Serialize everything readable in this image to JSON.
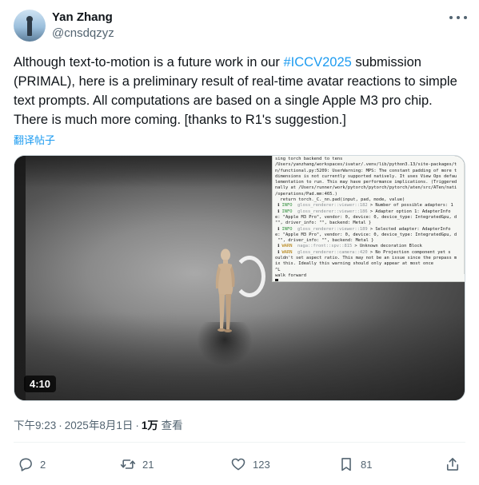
{
  "author": {
    "display_name": "Yan Zhang",
    "handle": "@cnsdqzyz"
  },
  "tweet": {
    "text_before": "Although text-to-motion is a future work in our ",
    "hashtag": "#ICCV2025",
    "text_after": " submission (PRIMAL), here is a preliminary result of real-time avatar reactions to simple text prompts. All computations are based on a single Apple M3 pro chip. There is much more coming. [thanks to R1's suggestion.]",
    "translate_label": "翻译帖子"
  },
  "video": {
    "duration": "4:10",
    "terminal_lines": [
      {
        "kind": "plain",
        "text": "sing torch backend to tens"
      },
      {
        "kind": "plain",
        "text": "/Users/yanzhang/workspaces/ivatar/.venv/lib/python3.13/site-packages/t"
      },
      {
        "kind": "plain",
        "text": "n/functional.py:5209: UserWarning: MPS: The constant padding of more t"
      },
      {
        "kind": "plain",
        "text": "dimensions is not currently supported natively. It uses View Ops defau"
      },
      {
        "kind": "plain",
        "text": "lementation to run. This may have performance implications. (Triggered"
      },
      {
        "kind": "plain",
        "text": "nally at /Users/runner/work/pytorch/pytorch/pytorch/aten/src/ATen/nati"
      },
      {
        "kind": "plain",
        "text": "/operations/Pad.mm:465.)"
      },
      {
        "kind": "plain",
        "text": "  return torch._C._nn.pad(input, pad, mode, value)"
      },
      {
        "kind": "info",
        "tag": "INFO",
        "muted": "gloss_renderer::viewer::182",
        "text": " > Number of possible adapters: 1"
      },
      {
        "kind": "info",
        "tag": "INFO",
        "muted": "gloss_renderer::viewer::186",
        "text": " > Adapter option 1: AdapterInfo"
      },
      {
        "kind": "plain",
        "text": "e: \"Apple M3 Pro\", vendor: 0, device: 0, device_type: IntegratedGpu, d"
      },
      {
        "kind": "plain",
        "text": "\"\", driver_info: \"\", backend: Metal }"
      },
      {
        "kind": "info",
        "tag": "INFO",
        "muted": "gloss_renderer::viewer::189",
        "text": " > Selected adapter: AdapterInfo"
      },
      {
        "kind": "plain",
        "text": "e: \"Apple M3 Pro\", vendor: 0, device: 0, device_type: IntegratedGpu, d"
      },
      {
        "kind": "plain",
        "text": " \"\", driver_info: \"\", backend: Metal }"
      },
      {
        "kind": "warn",
        "tag": "WARN",
        "muted": "naga::front::spv::815",
        "text": " > Unknown decoration Block"
      },
      {
        "kind": "warn",
        "tag": "WARN",
        "muted": "gloss_renderer::camera::420",
        "text": " > No Projection component yet s"
      },
      {
        "kind": "plain",
        "text": "ouldn't set aspect ratio. This may not be an issue since the prepass m"
      },
      {
        "kind": "plain",
        "text": "ix this. Ideally this warning should only appear at most once"
      },
      {
        "kind": "plain",
        "text": "^L"
      },
      {
        "kind": "plain",
        "text": "walk forward"
      }
    ]
  },
  "meta": {
    "time": "下午9:23",
    "separator": "·",
    "date": "2025年8月1日",
    "views_count": "1万",
    "views_label": "查看"
  },
  "actions": {
    "reply_count": "2",
    "repost_count": "21",
    "like_count": "123",
    "bookmark_count": "81"
  },
  "colors": {
    "accent": "#1d9bf0",
    "text_primary": "#0f1419",
    "text_secondary": "#536471",
    "divider": "#eff3f4"
  },
  "icons": {
    "more": "more-horizontal-icon",
    "reply": "reply-icon",
    "repost": "repost-icon",
    "like": "heart-icon",
    "bookmark": "bookmark-icon",
    "share": "share-icon"
  }
}
